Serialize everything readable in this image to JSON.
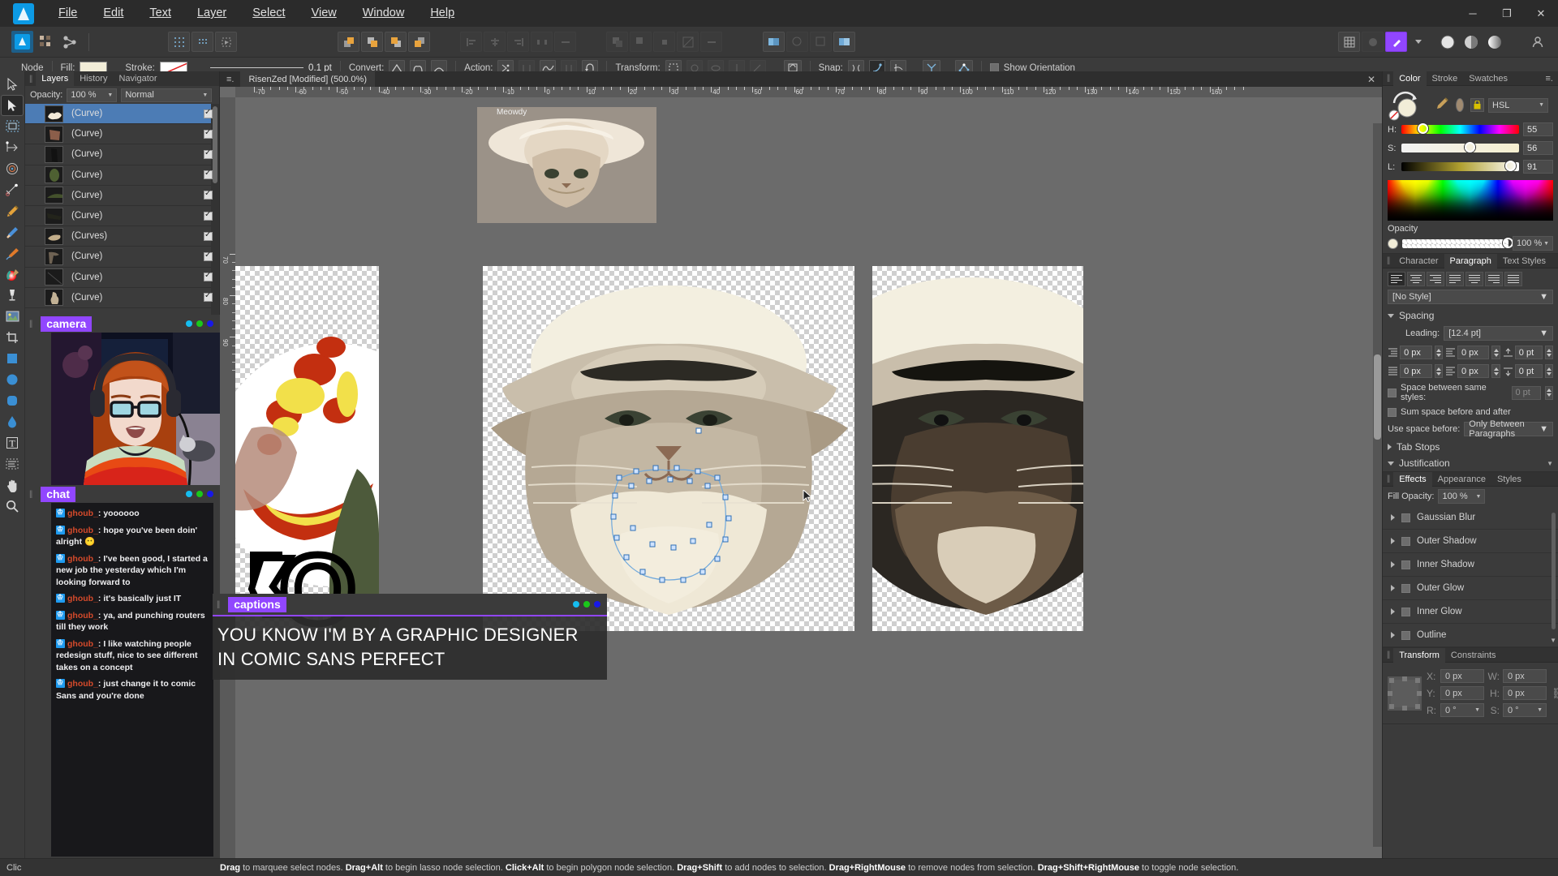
{
  "app": {
    "name": "Affinity Designer",
    "logo_icon": "affinity-logo-icon"
  },
  "titlebar": {
    "menus": [
      "File",
      "Edit",
      "Text",
      "Layer",
      "Select",
      "View",
      "Window",
      "Help"
    ],
    "window_buttons": [
      {
        "name": "minimize",
        "glyph": "─"
      },
      {
        "name": "maximize",
        "glyph": "❐"
      },
      {
        "name": "close",
        "glyph": "✕"
      }
    ],
    "account_icon": "person-icon"
  },
  "toolbar": {
    "persona_icons": [
      "designer-persona-icon",
      "pixel-persona-icon",
      "export-persona-icon"
    ],
    "group_view_icons": [
      "show-grid-icon",
      "snap-grid-icon",
      "transform-object-icon"
    ],
    "arrange_icons": [
      "move-to-front-icon",
      "move-forward-icon",
      "move-backward-icon",
      "move-to-back-icon"
    ],
    "align_icons": [
      "align-left-icon",
      "align-center-icon",
      "align-right-icon",
      "distribute-h-icon",
      "distribute-v-icon"
    ],
    "boolean_icons": [
      "add-icon",
      "subtract-icon",
      "intersect-icon",
      "divide-icon",
      "combine-icon"
    ],
    "right_icons": [
      "grid-settings-icon",
      "adjustment-icon",
      "color-picker-icon"
    ],
    "color_circle_icons": [
      "circle-white-icon",
      "circle-split-icon",
      "circle-gradient-icon"
    ]
  },
  "context_bar": {
    "tool_label": "Node",
    "fill_label": "Fill:",
    "fill_color": "#f2edd8",
    "stroke_label": "Stroke:",
    "stroke_none": true,
    "stroke_width": "0.1 pt",
    "convert_label": "Convert:",
    "convert_icons": [
      "convert-sharp-icon",
      "convert-smart-icon",
      "convert-smooth-icon"
    ],
    "action_label": "Action:",
    "action_icons": [
      "break-curve-icon",
      "close-curve-icon",
      "smooth-curve-icon",
      "join-curve-icon",
      "reverse-curve-icon"
    ],
    "transform_label": "Transform:",
    "transform_icons": [
      "show-bbox-icon",
      "rotate-center-icon",
      "hide-icon",
      "mirror-icon",
      "scale-icon"
    ],
    "transform_mode_icon": "transform-mode-icon",
    "snap_label": "Snap:",
    "snap_icons": [
      "snap-node-icon",
      "snap-curve-icon",
      "snap-tangent-icon",
      "snap-intersect-icon",
      "snap-geometry-icon"
    ],
    "show_orientation_label": "Show Orientation",
    "show_orientation_checked": false
  },
  "tools": [
    {
      "name": "move-tool",
      "icon": "cursor-arrow-icon",
      "selected": false
    },
    {
      "name": "node-tool",
      "icon": "node-cursor-icon",
      "selected": true
    },
    {
      "name": "artboard-tool",
      "icon": "artboard-icon",
      "selected": false
    },
    {
      "name": "corner-tool",
      "icon": "corner-icon",
      "selected": false
    },
    {
      "name": "transparency-tool",
      "icon": "transparency-target-icon",
      "selected": false
    },
    {
      "name": "vector-crop-tool",
      "icon": "vector-crop-icon",
      "selected": false
    },
    {
      "name": "pen-tool",
      "icon": "pen-nib-icon",
      "selected": false
    },
    {
      "name": "pencil-tool",
      "icon": "pencil-icon",
      "selected": false
    },
    {
      "name": "vector-brush-tool",
      "icon": "paintbrush-icon",
      "selected": false
    },
    {
      "name": "fill-tool",
      "icon": "color-wheel-icon",
      "selected": false
    },
    {
      "name": "pressure-tool",
      "icon": "goblet-icon",
      "selected": false
    },
    {
      "name": "place-image-tool",
      "icon": "image-icon",
      "selected": false
    },
    {
      "name": "crop-tool",
      "icon": "crop-icon",
      "selected": false
    },
    {
      "name": "rectangle-tool",
      "icon": "square-icon",
      "selected": false
    },
    {
      "name": "ellipse-tool",
      "icon": "circle-icon",
      "selected": false
    },
    {
      "name": "rounded-rect-tool",
      "icon": "rounded-square-icon",
      "selected": false
    },
    {
      "name": "teardrop-tool",
      "icon": "teardrop-icon",
      "selected": false
    },
    {
      "name": "artistic-text-tool",
      "icon": "text-t-icon",
      "selected": false
    },
    {
      "name": "frame-text-tool",
      "icon": "frame-text-icon",
      "selected": false
    },
    {
      "name": "hand-tool",
      "icon": "hand-icon",
      "selected": false
    },
    {
      "name": "zoom-tool",
      "icon": "magnifier-icon",
      "selected": false
    }
  ],
  "layers_panel": {
    "tabs": [
      {
        "label": "Layers",
        "active": true
      },
      {
        "label": "History",
        "active": false
      },
      {
        "label": "Navigator",
        "active": false
      }
    ],
    "opacity_label": "Opacity:",
    "opacity_value": "100 %",
    "blend_mode": "Normal",
    "rows": [
      {
        "name": "(Curve)",
        "selected": true,
        "checked": true,
        "thumb": "#f3ead8"
      },
      {
        "name": "(Curve)",
        "selected": false,
        "checked": true,
        "thumb": "#8b5e4a"
      },
      {
        "name": "(Curve)",
        "selected": false,
        "checked": true,
        "thumb": "#1a1a1a"
      },
      {
        "name": "(Curve)",
        "selected": false,
        "checked": true,
        "thumb": "#4e6032"
      },
      {
        "name": "(Curve)",
        "selected": false,
        "checked": true,
        "thumb": "#44512c"
      },
      {
        "name": "(Curve)",
        "selected": false,
        "checked": true,
        "thumb": "#23241b"
      },
      {
        "name": "(Curves)",
        "selected": false,
        "checked": true,
        "thumb": "#c3ae8b"
      },
      {
        "name": "(Curve)",
        "selected": false,
        "checked": true,
        "thumb": "#6e6253"
      },
      {
        "name": "(Curve)",
        "selected": false,
        "checked": true,
        "thumb": "#2a2a2a"
      },
      {
        "name": "(Curve)",
        "selected": false,
        "checked": true,
        "thumb": "#c2b195"
      }
    ]
  },
  "camera_overlay": {
    "title": "camera",
    "dots": [
      "#15bdf0",
      "#1ac81a",
      "#1818e8"
    ]
  },
  "chat_overlay": {
    "title": "chat",
    "dots": [
      "#15bdf0",
      "#1ac81a",
      "#1818e8"
    ],
    "messages": [
      {
        "user": "ghoub_",
        "text": "yoooooo"
      },
      {
        "user": "ghoub_",
        "text": "hope you've been doin' alright 😶"
      },
      {
        "user": "ghoub_",
        "text": "I've been good, I started a new job the yesterday which I'm looking forward to"
      },
      {
        "user": "ghoub_",
        "text": "it's basically just IT"
      },
      {
        "user": "ghoub_",
        "text": "ya, and punching routers till they work"
      },
      {
        "user": "ghoub_",
        "text": "I like watching people redesign stuff, nice to see different takes on a concept"
      },
      {
        "user": "ghoub_",
        "text": "just change it to comic Sans and you're done"
      }
    ]
  },
  "captions_overlay": {
    "title": "captions",
    "dots": [
      "#15bdf0",
      "#1ac81a",
      "#1818e8"
    ],
    "text": "YOU KNOW I'M BY A GRAPHIC DESIGNER IN COMIC SANS PERFECT"
  },
  "document": {
    "tab_title": "RisenZed [Modified] (500.0%)",
    "close_glyph": "✕",
    "menu_icon": "tab-menu-icon",
    "artboard_label": "Meowdy",
    "ruler_h_labels": [
      "-70",
      "-60",
      "-50",
      "-40",
      "-30",
      "-20",
      "-10",
      "0",
      "10",
      "20",
      "30",
      "40",
      "50",
      "60",
      "70",
      "80",
      "90",
      "100",
      "110",
      "120",
      "130",
      "140",
      "150",
      "160"
    ],
    "ruler_v_labels": [
      "70",
      "80",
      "90"
    ],
    "unit": "px"
  },
  "color_panel": {
    "tabs": [
      {
        "label": "Color",
        "active": true
      },
      {
        "label": "Stroke",
        "active": false
      },
      {
        "label": "Swatches",
        "active": false
      }
    ],
    "menu_icon": "panel-menu-icon",
    "fill_swatch_color": "#f2edd8",
    "secondary_swatch_color": "#a08a70",
    "picker_icon": "eyedropper-icon",
    "lock_icon": "lock-icon",
    "model": "HSL",
    "channels": [
      {
        "label": "H:",
        "value": "55",
        "pos": 0.155
      },
      {
        "label": "S:",
        "value": "56",
        "pos": 0.56
      },
      {
        "label": "L:",
        "value": "91",
        "pos": 0.91
      }
    ],
    "opacity_label": "Opacity",
    "opacity_value": "100 %"
  },
  "paragraph_panel": {
    "tabs": [
      {
        "label": "Character",
        "active": false
      },
      {
        "label": "Paragraph",
        "active": true
      },
      {
        "label": "Text Styles",
        "active": false
      }
    ],
    "align_buttons": [
      "align-left-icon",
      "align-center-icon",
      "align-right-icon",
      "justify-left-icon",
      "justify-center-icon",
      "justify-right-icon",
      "justify-all-icon"
    ],
    "style": "[No Style]",
    "spacing_label": "Spacing",
    "leading_label": "Leading:",
    "leading_value": "[12.4 pt]",
    "fields": [
      {
        "icon": "indent-left-icon",
        "value": "0 px"
      },
      {
        "icon": "indent-right-icon",
        "value": "0 px"
      },
      {
        "icon": "space-before-icon",
        "value": "0 pt"
      },
      {
        "icon": "indent-first-icon",
        "value": "0 px"
      },
      {
        "icon": "indent-last-icon",
        "value": "0 px"
      },
      {
        "icon": "space-after-icon",
        "value": "0 pt"
      }
    ],
    "space_same_styles_label": "Space between same styles:",
    "space_same_styles_value": "0 pt",
    "space_same_styles_checked": false,
    "sum_space_label": "Sum space before and after",
    "sum_space_checked": false,
    "use_space_before_label": "Use space before:",
    "use_space_before_value": "Only Between Paragraphs",
    "tab_stops_label": "Tab Stops",
    "justification_label": "Justification"
  },
  "effects_panel": {
    "tabs": [
      {
        "label": "Effects",
        "active": true
      },
      {
        "label": "Appearance",
        "active": false
      },
      {
        "label": "Styles",
        "active": false
      }
    ],
    "fill_opacity_label": "Fill Opacity:",
    "fill_opacity_value": "100 %",
    "effects": [
      {
        "label": "Gaussian Blur",
        "checked": false
      },
      {
        "label": "Outer Shadow",
        "checked": false
      },
      {
        "label": "Inner Shadow",
        "checked": false
      },
      {
        "label": "Outer Glow",
        "checked": false
      },
      {
        "label": "Inner Glow",
        "checked": false
      },
      {
        "label": "Outline",
        "checked": false
      }
    ]
  },
  "transform_panel": {
    "tabs": [
      {
        "label": "Transform",
        "active": true
      },
      {
        "label": "Constraints",
        "active": false
      }
    ],
    "fields": [
      {
        "label": "X:",
        "value": "0 px"
      },
      {
        "label": "W:",
        "value": "0 px"
      },
      {
        "label": "Y:",
        "value": "0 px"
      },
      {
        "label": "H:",
        "value": "0 px"
      },
      {
        "label": "R:",
        "value": "0 °"
      },
      {
        "label": "S:",
        "value": "0 °"
      }
    ],
    "link_icon": "link-ratio-icon"
  },
  "statusbar": {
    "left_text": "Clic",
    "hint_parts": [
      {
        "t": "Drag",
        "b": true
      },
      {
        "t": " to marquee select nodes. ",
        "b": false
      },
      {
        "t": "Drag+Alt",
        "b": true
      },
      {
        "t": " to begin lasso node selection. ",
        "b": false
      },
      {
        "t": "Click+Alt",
        "b": true
      },
      {
        "t": " to begin polygon node selection. ",
        "b": false
      },
      {
        "t": "Drag+Shift",
        "b": true
      },
      {
        "t": " to add nodes to selection. ",
        "b": false
      },
      {
        "t": "Drag+RightMouse",
        "b": true
      },
      {
        "t": " to remove nodes from selection. ",
        "b": false
      },
      {
        "t": "Drag+Shift+RightMouse",
        "b": true
      },
      {
        "t": " to toggle node selection.",
        "b": false
      }
    ]
  },
  "colors": {
    "accent_purple": "#9146ff",
    "selection_blue": "#4c7cb5",
    "panel_bg": "#3b3b3b",
    "canvas_bg": "#6b6b6b"
  }
}
